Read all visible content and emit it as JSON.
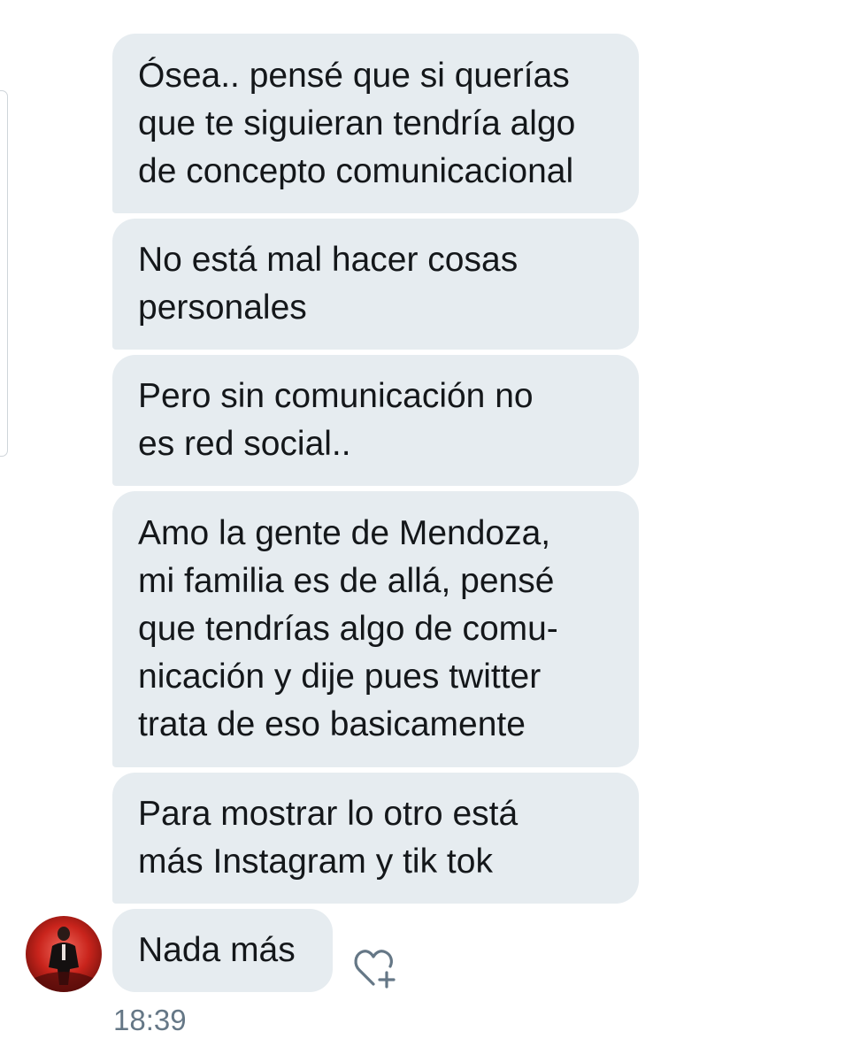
{
  "messages": [
    {
      "text": "Ósea.. pensé que si querías\nque te siguieran tendría algo\nde concepto comunicacional"
    },
    {
      "text": "No está mal hacer cosas\npersonales"
    },
    {
      "text": "Pero sin comunicación no\nes red social.."
    },
    {
      "text": "Amo la gente de Mendoza,\nmi familia es de allá, pensé\nque tendrías algo de comu-\nnicación y dije pues twitter\ntrata de eso basicamente"
    },
    {
      "text": "Para mostrar lo otro está\nmás Instagram y tik tok"
    },
    {
      "text": "Nada más"
    }
  ],
  "timestamp": "18:39",
  "icons": {
    "like": "heart-plus-icon",
    "avatar": "user-avatar"
  },
  "colors": {
    "bubble_bg": "#e6ecf0",
    "text": "#14171a",
    "timestamp": "#657786",
    "icon": "#657786"
  }
}
